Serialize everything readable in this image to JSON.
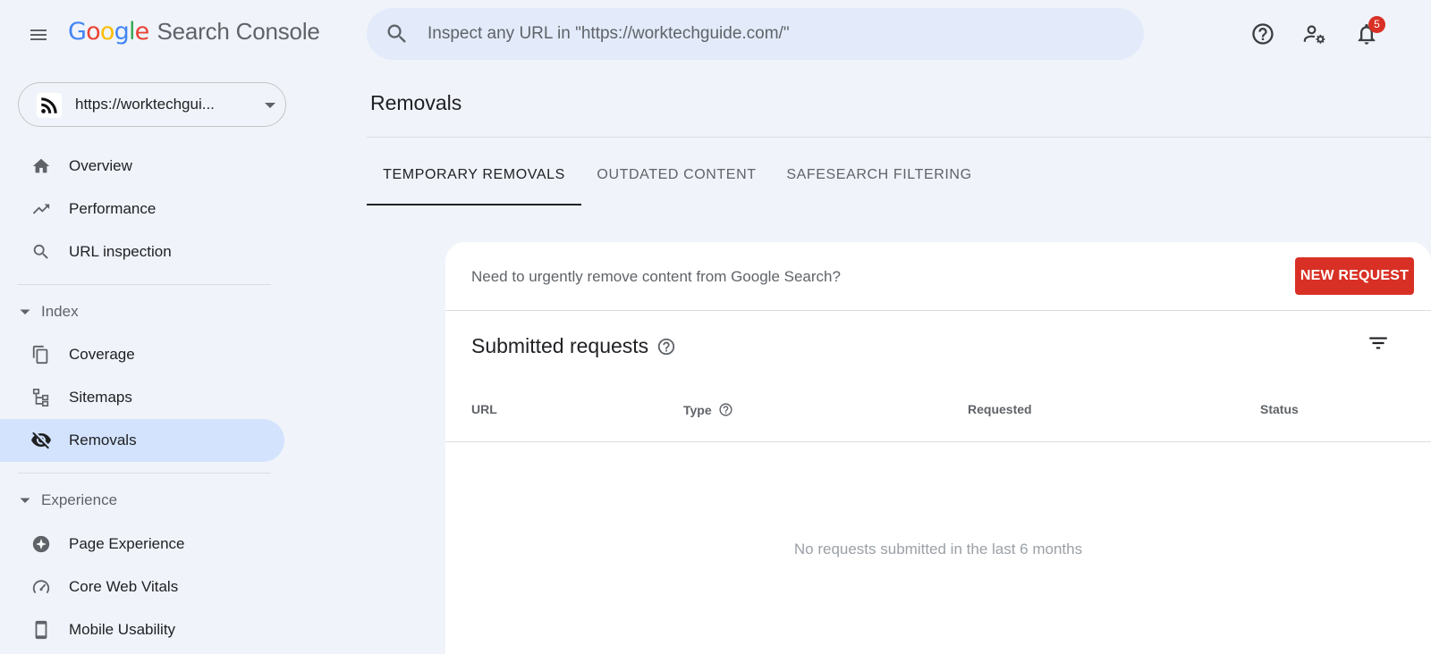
{
  "header": {
    "logo_letters": [
      {
        "char": "G",
        "color": "#4285F4"
      },
      {
        "char": "o",
        "color": "#EA4335"
      },
      {
        "char": "o",
        "color": "#FBBC05"
      },
      {
        "char": "g",
        "color": "#4285F4"
      },
      {
        "char": "l",
        "color": "#34A853"
      },
      {
        "char": "e",
        "color": "#EA4335"
      }
    ],
    "product": "Search Console",
    "search_placeholder": "Inspect any URL in \"https://worktechguide.com/\"",
    "icons": [
      "menu-icon",
      "search-icon",
      "help-icon",
      "manage-users-icon",
      "notifications-icon"
    ],
    "notifications_count": "5"
  },
  "sidebar": {
    "property_url": "https://worktechgui...",
    "top_items": [
      {
        "label": "Overview",
        "icon": "home-icon"
      },
      {
        "label": "Performance",
        "icon": "trending-up-icon"
      },
      {
        "label": "URL inspection",
        "icon": "search-icon"
      }
    ],
    "index_section": "Index",
    "index_items": [
      {
        "label": "Coverage",
        "icon": "coverage-icon"
      },
      {
        "label": "Sitemaps",
        "icon": "sitemaps-icon"
      },
      {
        "label": "Removals",
        "icon": "eye-off-icon",
        "active": true
      }
    ],
    "experience_section": "Experience",
    "experience_items": [
      {
        "label": "Page Experience",
        "icon": "page-experience-icon"
      },
      {
        "label": "Core Web Vitals",
        "icon": "speed-gauge-icon"
      },
      {
        "label": "Mobile Usability",
        "icon": "smartphone-icon"
      }
    ]
  },
  "main": {
    "title": "Removals",
    "tabs": [
      {
        "label": "TEMPORARY REMOVALS",
        "active": true
      },
      {
        "label": "OUTDATED CONTENT"
      },
      {
        "label": "SAFESEARCH FILTERING"
      }
    ],
    "urgent_text": "Need to urgently remove content from Google Search?",
    "new_request_label": "NEW REQUEST",
    "submitted_title": "Submitted requests",
    "columns": [
      "URL",
      "Type",
      "Requested",
      "Status"
    ],
    "empty_text": "No requests submitted in the last 6 months"
  },
  "colors": {
    "background": "#f0f4fa",
    "search_bg": "#e3ebfa",
    "active_nav": "#d3e3fd",
    "new_request": "#d93025",
    "badge": "#d93025"
  }
}
